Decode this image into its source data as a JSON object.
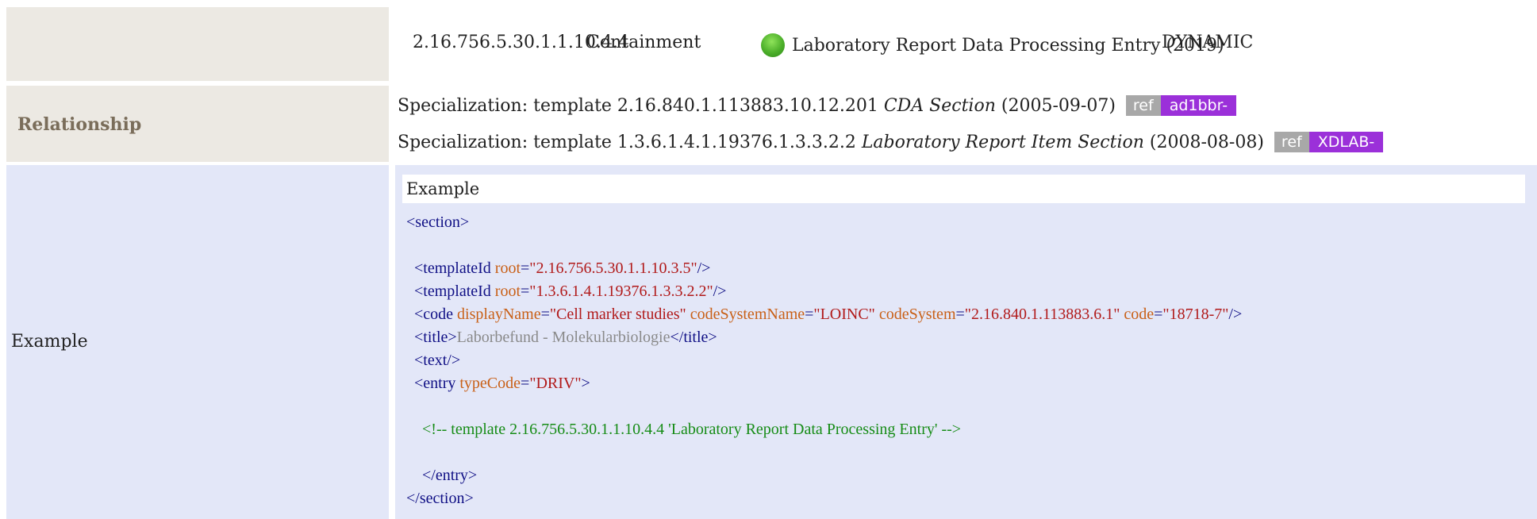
{
  "containment_row": {
    "oid": "2.16.756.5.30.1.1.10.4.4",
    "type": "Containment",
    "status_icon": "green-circle-icon",
    "status_color": "#4caf2a",
    "name": "Laboratory Report Data Processing Entry (2019)",
    "flexibility": "DYNAMIC"
  },
  "relationship_row": {
    "label": "Relationship",
    "items": [
      {
        "prefix": "Specialization: template 2.16.840.1.113883.10.12.201",
        "name": "CDA Section",
        "date": "(2005-09-07)",
        "ref_label": "ref",
        "ref_id": "ad1bbr-"
      },
      {
        "prefix": "Specialization: template 1.3.6.1.4.1.19376.1.3.3.2.2",
        "name": "Laboratory Report Item Section",
        "date": "(2008-08-08)",
        "ref_label": "ref",
        "ref_id": "XDLAB-"
      }
    ]
  },
  "example_row": {
    "label": "Example",
    "header": "Example",
    "code": {
      "section_open": "<section>",
      "templateId_1": {
        "tag": "<templateId ",
        "attr": "root",
        "value": "\"2.16.756.5.30.1.1.10.3.5\"",
        "close": "/>"
      },
      "templateId_2": {
        "tag": "<templateId ",
        "attr": "root",
        "value": "\"1.3.6.1.4.1.19376.1.3.3.2.2\"",
        "close": "/>"
      },
      "code_el": {
        "tag": "<code ",
        "a1": "displayName",
        "v1": "\"Cell marker studies\"",
        "a2": "codeSystemName",
        "v2": "\"LOINC\"",
        "a3": "codeSystem",
        "v3": "\"2.16.840.1.113883.6.1\"",
        "a4": "code",
        "v4": "\"18718-7\"",
        "close": "/>"
      },
      "title_open": "<title>",
      "title_text": "Laborbefund - Molekularbiologie",
      "title_close": "</title>",
      "text_el": "<text/>",
      "entry": {
        "tag": "<entry ",
        "attr": "typeCode",
        "value": "\"DRIV\"",
        "close": ">"
      },
      "comment": "<!-- template 2.16.756.5.30.1.1.10.4.4 'Laboratory Report Data Processing Entry' -->",
      "entry_close": "</entry>",
      "section_close": "</section>"
    }
  }
}
